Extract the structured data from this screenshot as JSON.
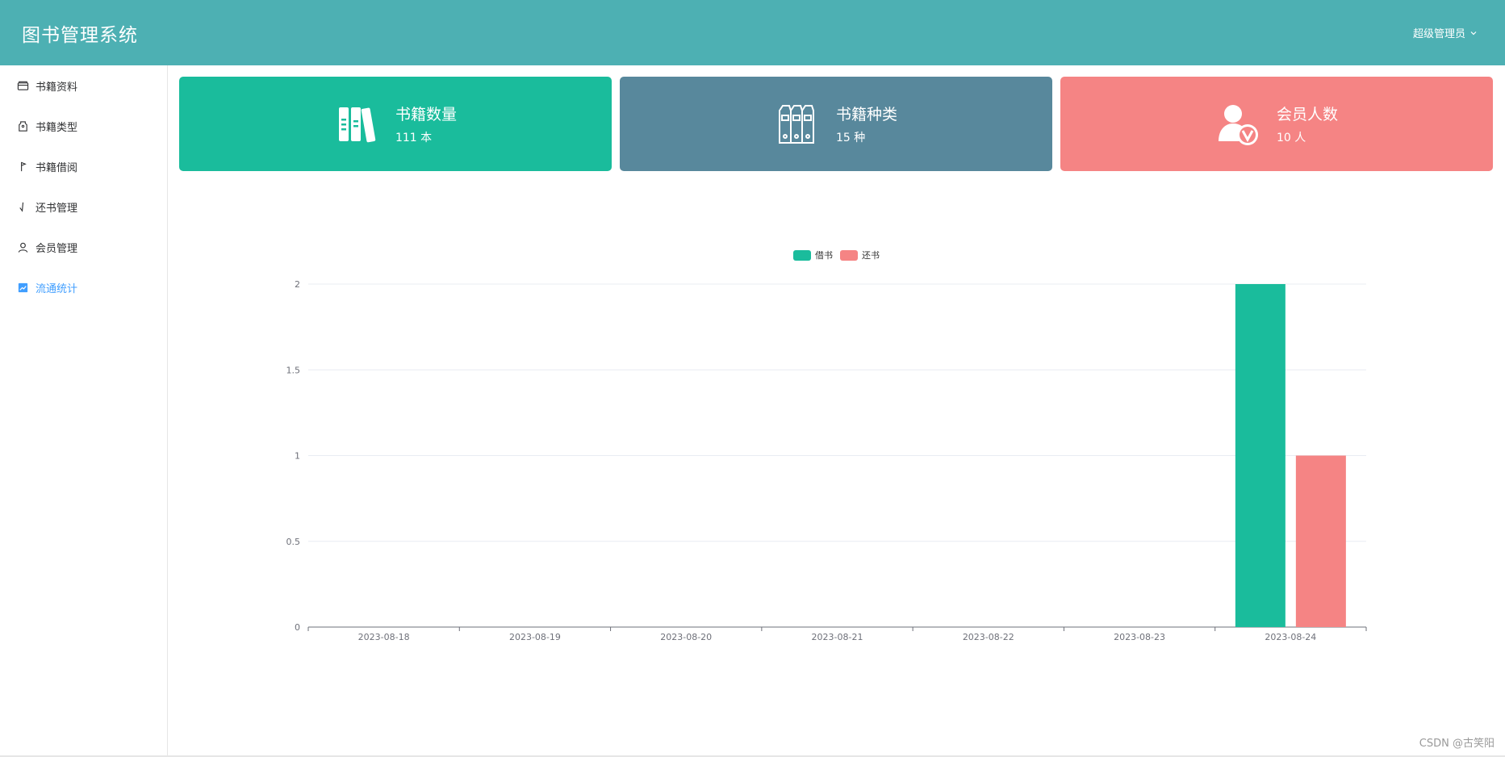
{
  "header": {
    "title": "图书管理系统",
    "user_label": "超级管理员",
    "bg_color": "#4db0b3"
  },
  "sidebar": {
    "items": [
      {
        "label": "书籍资料",
        "icon": "wallet-icon",
        "active": false
      },
      {
        "label": "书籍类型",
        "icon": "tag-icon",
        "active": false
      },
      {
        "label": "书籍借阅",
        "icon": "flag-icon",
        "active": false
      },
      {
        "label": "还书管理",
        "icon": "check-icon",
        "active": false
      },
      {
        "label": "会员管理",
        "icon": "user-icon",
        "active": false
      },
      {
        "label": "流通统计",
        "icon": "chart-icon",
        "active": true
      }
    ],
    "active_color": "#409eff"
  },
  "cards": [
    {
      "title": "书籍数量",
      "value": "111 本",
      "color": "#1abc9c",
      "icon": "books-icon"
    },
    {
      "title": "书籍种类",
      "value": "15 种",
      "color": "#58889c",
      "icon": "binders-icon"
    },
    {
      "title": "会员人数",
      "value": "10 人",
      "color": "#f58484",
      "icon": "member-verified-icon"
    }
  ],
  "chart_data": {
    "type": "bar",
    "title": "",
    "xlabel": "",
    "ylabel": "",
    "categories": [
      "2023-08-18",
      "2023-08-19",
      "2023-08-20",
      "2023-08-21",
      "2023-08-22",
      "2023-08-23",
      "2023-08-24"
    ],
    "series": [
      {
        "name": "借书",
        "color": "#1abc9c",
        "values": [
          0,
          0,
          0,
          0,
          0,
          0,
          2
        ]
      },
      {
        "name": "还书",
        "color": "#f58484",
        "values": [
          0,
          0,
          0,
          0,
          0,
          0,
          1
        ]
      }
    ],
    "ylim": [
      0,
      2
    ],
    "yticks": [
      "0",
      "0.5",
      "1",
      "1.5",
      "2"
    ],
    "grid": true,
    "legend_position": "top-center"
  },
  "watermark": "CSDN @古笑阳"
}
